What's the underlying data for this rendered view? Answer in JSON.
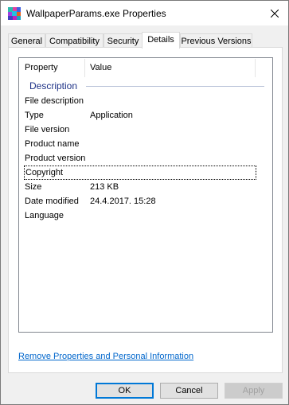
{
  "window": {
    "title": "WallpaperParams.exe Properties"
  },
  "tabs": [
    {
      "label": "General"
    },
    {
      "label": "Compatibility"
    },
    {
      "label": "Security"
    },
    {
      "label": "Details"
    },
    {
      "label": "Previous Versions"
    }
  ],
  "details": {
    "columns": {
      "property": "Property",
      "value": "Value"
    },
    "group": "Description",
    "rows": [
      {
        "property": "File description",
        "value": ""
      },
      {
        "property": "Type",
        "value": "Application"
      },
      {
        "property": "File version",
        "value": ""
      },
      {
        "property": "Product name",
        "value": ""
      },
      {
        "property": "Product version",
        "value": ""
      },
      {
        "property": "Copyright",
        "value": ""
      },
      {
        "property": "Size",
        "value": "213 KB"
      },
      {
        "property": "Date modified",
        "value": "24.4.2017. 15:28"
      },
      {
        "property": "Language",
        "value": ""
      }
    ]
  },
  "link": "Remove Properties and Personal Information",
  "buttons": {
    "ok": "OK",
    "cancel": "Cancel",
    "apply": "Apply"
  },
  "colors": {
    "accent": "#0078d7",
    "group_text": "#1e3287",
    "link": "#0066cc"
  }
}
